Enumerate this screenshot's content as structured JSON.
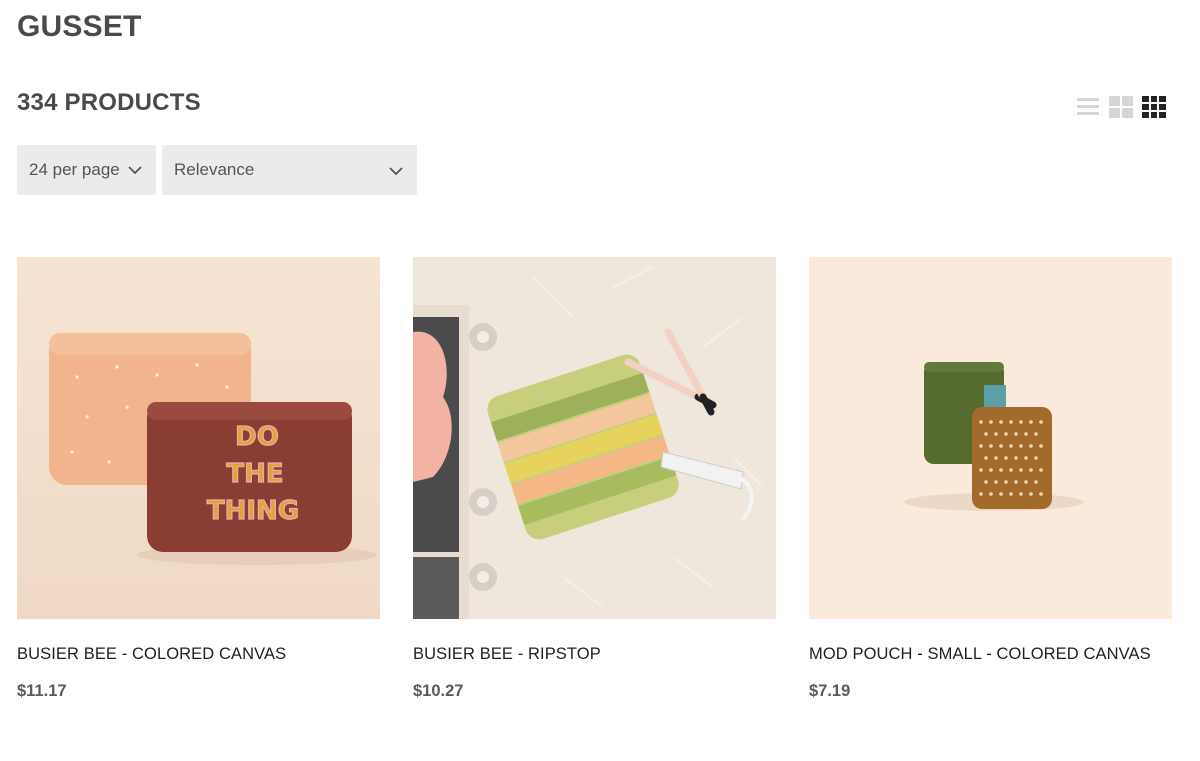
{
  "page": {
    "brand": "GUSSET",
    "product_count": "334 PRODUCTS"
  },
  "view_options": [
    {
      "name": "list",
      "icon": "list-view-icon",
      "active": false
    },
    {
      "name": "grid",
      "icon": "grid-view-icon",
      "active": false
    },
    {
      "name": "dense-grid",
      "icon": "dense-grid-view-icon",
      "active": true
    }
  ],
  "controls": {
    "per_page": "24 per page",
    "sort": "Relevance"
  },
  "products": [
    {
      "title": "BUSIER BEE - COLORED CANVAS",
      "price": "$11.17",
      "image_text": [
        "DO",
        "THE",
        "THING"
      ]
    },
    {
      "title": "BUSIER BEE - RIPSTOP",
      "price": "$10.27"
    },
    {
      "title": "MOD POUCH - SMALL - COLORED CANVAS",
      "price": "$7.19"
    }
  ],
  "colors": {
    "heading": "#4a4a4a",
    "select_bg": "#ebebeb",
    "icon_inactive": "#d6d6d6",
    "icon_active": "#222222",
    "price": "#5a5a5a"
  }
}
